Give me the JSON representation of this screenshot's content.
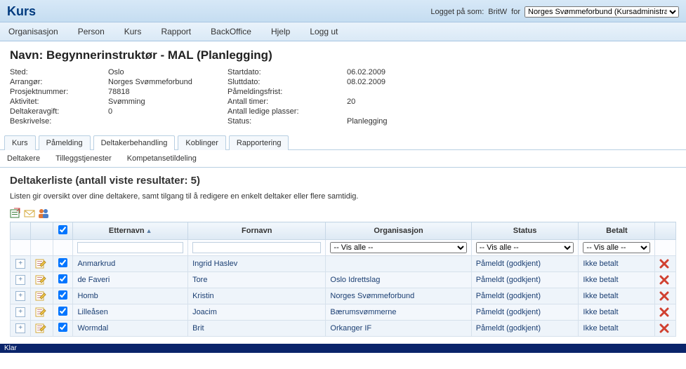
{
  "header": {
    "app_title": "Kurs",
    "logged_prefix": "Logget på som:",
    "user": "BritW",
    "for": "for",
    "org_select": "Norges Svømmeforbund (Kursadministrator)"
  },
  "menu": {
    "items": [
      "Organisasjon",
      "Person",
      "Kurs",
      "Rapport",
      "BackOffice",
      "Hjelp",
      "Logg ut"
    ]
  },
  "course": {
    "name_label": "Navn:",
    "name": "Begynnerinstruktør - MAL (Planlegging)",
    "left": {
      "sted_l": "Sted:",
      "sted": "Oslo",
      "arr_l": "Arrangør:",
      "arr": "Norges Svømmeforbund",
      "proj_l": "Prosjektnummer:",
      "proj": "78818",
      "akt_l": "Aktivitet:",
      "akt": "Svømming",
      "avg_l": "Deltakeravgift:",
      "avg": "0",
      "besk_l": "Beskrivelse:",
      "besk": ""
    },
    "right": {
      "start_l": "Startdato:",
      "start": "06.02.2009",
      "slutt_l": "Sluttdato:",
      "slutt": "08.02.2009",
      "frist_l": "Påmeldingsfrist:",
      "frist": "",
      "timer_l": "Antall timer:",
      "timer": "20",
      "ledige_l": "Antall ledige plasser:",
      "ledige": "",
      "status_l": "Status:",
      "status": "Planlegging"
    }
  },
  "tabs": [
    "Kurs",
    "Påmelding",
    "Deltakerbehandling",
    "Koblinger",
    "Rapportering"
  ],
  "activeTab": 2,
  "subtabs": [
    "Deltakere",
    "Tilleggstjenester",
    "Kompetansetildeling"
  ],
  "list": {
    "title": "Deltakerliste (antall viste resultater: 5)",
    "desc": "Listen gir oversikt over dine deltakere, samt tilgang til å redigere en enkelt deltaker eller flere samtidig.",
    "cols": {
      "etternavn": "Etternavn",
      "fornavn": "Fornavn",
      "org": "Organisasjon",
      "status": "Status",
      "betalt": "Betalt"
    },
    "filters": {
      "vis_alle": "-- Vis alle --"
    },
    "rows": [
      {
        "etternavn": "Anmarkrud",
        "fornavn": "Ingrid Haslev",
        "org": "",
        "status": "Påmeldt (godkjent)",
        "betalt": "Ikke betalt"
      },
      {
        "etternavn": "de Faveri",
        "fornavn": "Tore",
        "org": "Oslo Idrettslag",
        "status": "Påmeldt (godkjent)",
        "betalt": "Ikke betalt"
      },
      {
        "etternavn": "Homb",
        "fornavn": "Kristin",
        "org": "Norges Svømmeforbund",
        "status": "Påmeldt (godkjent)",
        "betalt": "Ikke betalt"
      },
      {
        "etternavn": "Lilleåsen",
        "fornavn": "Joacim",
        "org": "Bærumsvømmerne",
        "status": "Påmeldt (godkjent)",
        "betalt": "Ikke betalt"
      },
      {
        "etternavn": "Wormdal",
        "fornavn": "Brit",
        "org": "Orkanger IF",
        "status": "Påmeldt (godkjent)",
        "betalt": "Ikke betalt"
      }
    ]
  },
  "statusbar": "Klar"
}
